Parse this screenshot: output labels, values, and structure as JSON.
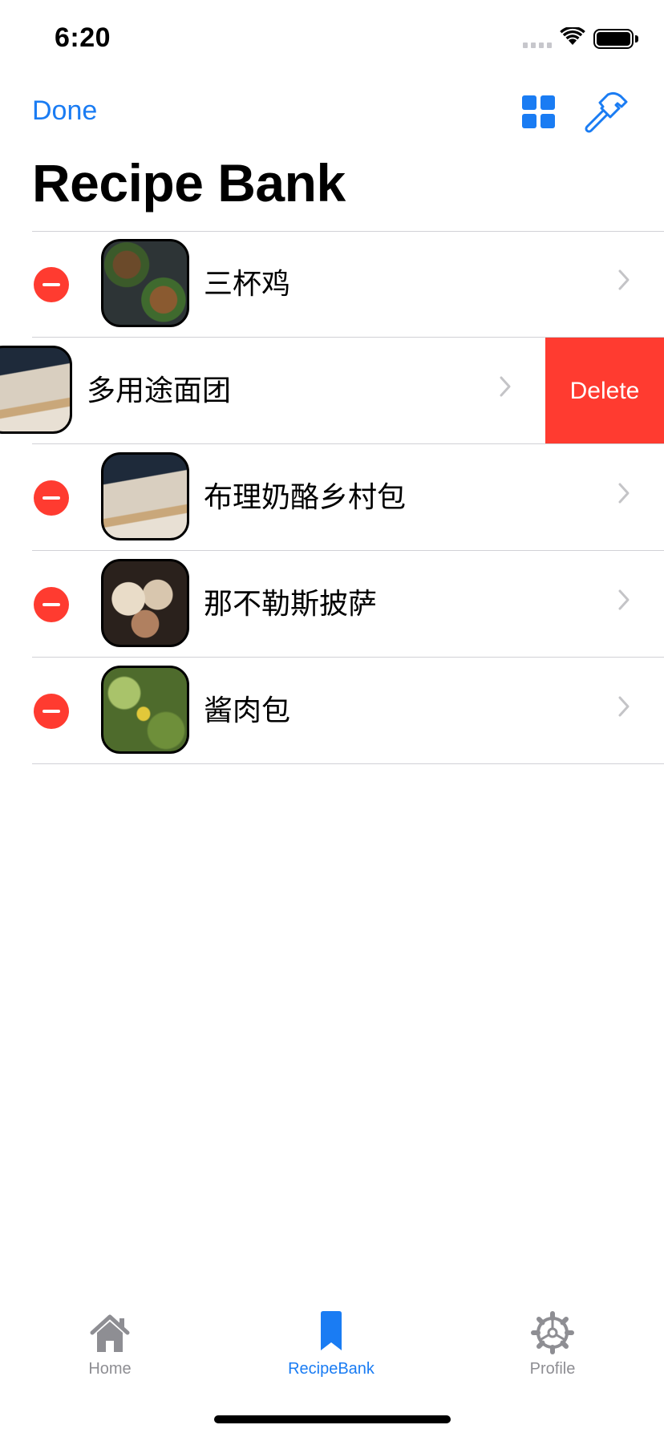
{
  "status_bar": {
    "time": "6:20"
  },
  "nav": {
    "done_label": "Done",
    "title": "Recipe Bank"
  },
  "list": {
    "items": [
      {
        "label": "三杯鸡"
      },
      {
        "label": "多用途面团",
        "swipe_action": "Delete"
      },
      {
        "label": "布理奶酪乡村包"
      },
      {
        "label": "那不勒斯披萨"
      },
      {
        "label": "酱肉包"
      }
    ]
  },
  "tab_bar": {
    "tabs": [
      {
        "label": "Home",
        "icon": "house-icon",
        "selected": false
      },
      {
        "label": "RecipeBank",
        "icon": "bookmark-icon",
        "selected": true
      },
      {
        "label": "Profile",
        "icon": "gear-icon",
        "selected": false
      }
    ]
  },
  "colors": {
    "accent": "#1a7cf3",
    "destructive": "#ff3b30",
    "inactive_tab": "#8e8e93",
    "separator": "#d1d1d6"
  }
}
